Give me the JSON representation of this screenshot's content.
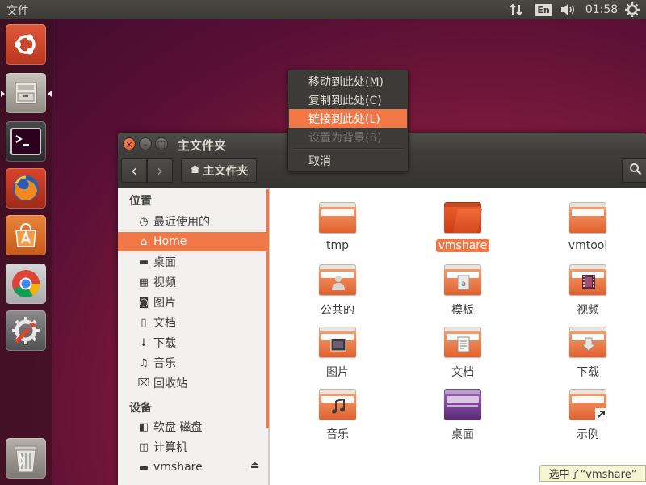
{
  "top_panel": {
    "app_title": "文件",
    "keyboard_layout": "En",
    "clock": "01:58",
    "icons": [
      "network-updown-icon",
      "volume-icon",
      "gear-icon"
    ]
  },
  "launcher": {
    "items": [
      {
        "name": "ubuntu-dash-icon"
      },
      {
        "name": "files-icon",
        "running": true
      },
      {
        "name": "terminal-icon"
      },
      {
        "name": "firefox-icon"
      },
      {
        "name": "software-center-icon"
      },
      {
        "name": "chrome-icon"
      },
      {
        "name": "system-settings-icon"
      },
      {
        "name": "trash-icon"
      }
    ]
  },
  "window": {
    "title": "主文件夹",
    "breadcrumb": "主文件夹",
    "nav_back": "‹",
    "nav_forward": "›"
  },
  "sidebar": {
    "places_heading": "位置",
    "places": [
      {
        "label": "最近使用的",
        "icon": "clock-icon",
        "glyph": "◷"
      },
      {
        "label": "Home",
        "icon": "home-icon",
        "glyph": "⌂",
        "active": true
      },
      {
        "label": "桌面",
        "icon": "desktop-folder-icon",
        "glyph": "▬"
      },
      {
        "label": "视频",
        "icon": "video-icon",
        "glyph": "▦"
      },
      {
        "label": "图片",
        "icon": "camera-icon",
        "glyph": "◙"
      },
      {
        "label": "文档",
        "icon": "document-icon",
        "glyph": "▯"
      },
      {
        "label": "下载",
        "icon": "download-icon",
        "glyph": "↓"
      },
      {
        "label": "音乐",
        "icon": "music-icon",
        "glyph": "♫"
      },
      {
        "label": "回收站",
        "icon": "trash-icon",
        "glyph": "⌧"
      }
    ],
    "devices_heading": "设备",
    "devices": [
      {
        "label": "软盘 磁盘",
        "icon": "floppy-icon",
        "glyph": "◧"
      },
      {
        "label": "计算机",
        "icon": "computer-icon",
        "glyph": "◫"
      },
      {
        "label": "vmshare",
        "icon": "drive-icon",
        "glyph": "▬"
      }
    ],
    "eject_glyph": "⏏"
  },
  "files": [
    {
      "label": "tmp",
      "emblem": "none"
    },
    {
      "label": "vmshare",
      "emblem": "open-folder",
      "selected": true
    },
    {
      "label": "vmtool",
      "emblem": "none"
    },
    {
      "label": "公共的",
      "emblem": "person"
    },
    {
      "label": "模板",
      "emblem": "template"
    },
    {
      "label": "视频",
      "emblem": "film"
    },
    {
      "label": "图片",
      "emblem": "picture"
    },
    {
      "label": "文档",
      "emblem": "text"
    },
    {
      "label": "下载",
      "emblem": "download"
    },
    {
      "label": "音乐",
      "emblem": "music"
    },
    {
      "label": "桌面",
      "emblem": "desktop"
    },
    {
      "label": "示例",
      "emblem": "link"
    }
  ],
  "context_menu": {
    "items": [
      {
        "label": "移动到此处(M)"
      },
      {
        "label": "复制到此处(C)"
      },
      {
        "label": "链接到此处(L)",
        "highlight": true
      },
      {
        "label": "设置为背景(B)",
        "disabled": true
      },
      {
        "label": "取消"
      }
    ]
  },
  "status": {
    "text": "选中了“vmshare”"
  },
  "colors": {
    "accent": "#f07746",
    "panel": "#3c3b37",
    "desktop": "#8c1f3f"
  }
}
